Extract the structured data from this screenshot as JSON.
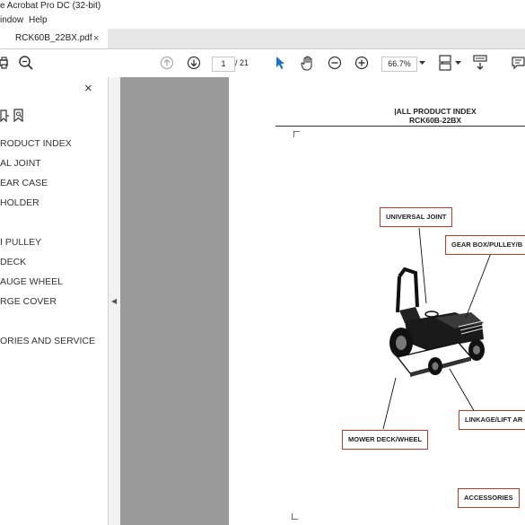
{
  "window": {
    "title": "e Acrobat Pro DC (32-bit)"
  },
  "menu": {
    "items": [
      "indow",
      "Help"
    ]
  },
  "tab": {
    "label": "RCK60B_22BX.pdf",
    "close": "×"
  },
  "toolbar": {
    "page_current": "1",
    "page_total": "/  21",
    "zoom": "66.7%"
  },
  "sidebar": {
    "close": "×",
    "bookmarks": [
      "RODUCT INDEX",
      "AL JOINT",
      "EAR CASE",
      "HOLDER",
      "I PULLEY",
      "DECK",
      "AUGE WHEEL",
      "RGE COVER",
      "ORIES AND SERVICE"
    ]
  },
  "document": {
    "title": "|ALL PRODUCT INDEX",
    "subtitle": "RCK60B-22BX",
    "callouts": {
      "universal_joint": "UNIVERSAL JOINT",
      "gear_box": "GEAR BOX/PULLEY/B",
      "linkage": "LINKAGE/LIFT AR",
      "mower_deck": "MOWER DECK/WHEEL",
      "accessories": "ACCESSORIES"
    }
  },
  "colors": {
    "callout_border": "#c0392b",
    "viewer_bg": "#9a9a9a",
    "accent_icon": "#1a73c9"
  }
}
